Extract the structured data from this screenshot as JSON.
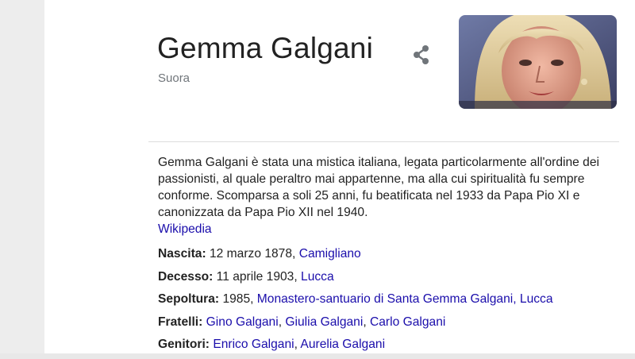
{
  "header": {
    "title": "Gemma Galgani",
    "subtitle": "Suora"
  },
  "icons": {
    "share": "share-icon"
  },
  "description": {
    "text": "Gemma Galgani è stata una mistica italiana, legata particolarmente all'ordine dei passionisti, al quale peraltro mai appartenne, ma alla cui spiritualità fu sempre conforme. Scomparsa a soli 25 anni, fu beatificata nel 1933 da Papa Pio XI e canonizzata da Papa Pio XII nel 1940.",
    "source_label": "Wikipedia"
  },
  "facts": {
    "nascita": {
      "label": "Nascita:",
      "text": " 12 marzo 1878, ",
      "link": "Camigliano"
    },
    "decesso": {
      "label": "Decesso:",
      "text": " 11 aprile 1903, ",
      "link": "Lucca"
    },
    "sepoltura": {
      "label": "Sepoltura:",
      "text": " 1985, ",
      "link": "Monastero-santuario di Santa Gemma Galgani, Lucca"
    },
    "fratelli": {
      "label": "Fratelli:",
      "links": [
        "Gino Galgani",
        "Giulia Galgani",
        "Carlo Galgani"
      ]
    },
    "genitori": {
      "label": "Genitori:",
      "links": [
        "Enrico Galgani",
        "Aurelia Galgani"
      ]
    }
  },
  "colors": {
    "link": "#1a0dab",
    "text": "#222222",
    "muted": "#70757a"
  }
}
